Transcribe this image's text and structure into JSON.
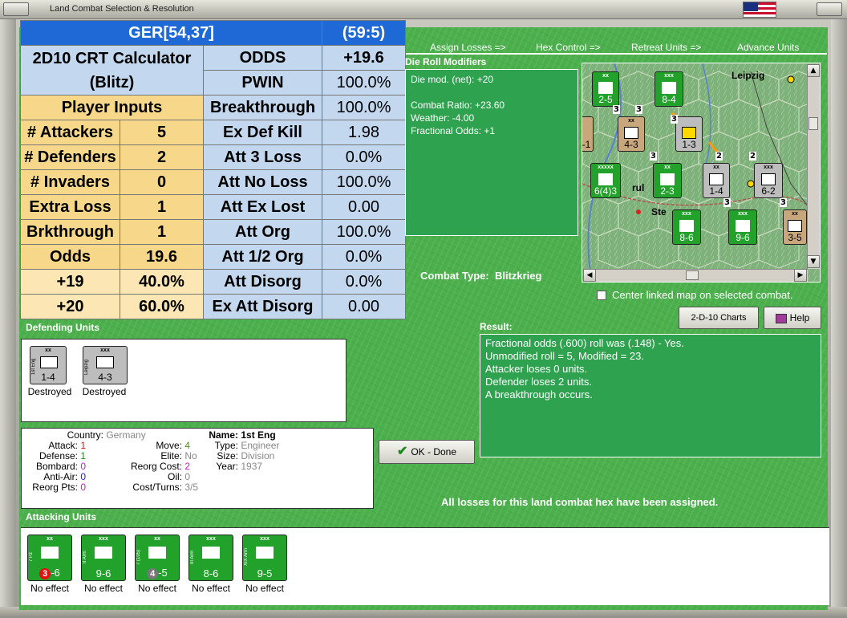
{
  "window": {
    "title": "Land Combat Selection & Resolution"
  },
  "menu": {
    "assign_losses": "Assign Losses =>",
    "hex_control": "Hex Control =>",
    "retreat_units": "Retreat Units =>",
    "advance_units": "Advance Units"
  },
  "crt": {
    "header_left": "GER[54,37]",
    "header_right": "(59:5)",
    "calc_title_1": "2D10 CRT Calculator",
    "calc_title_2": "(Blitz)",
    "player_inputs": "Player Inputs",
    "inputs": [
      {
        "label": "# Attackers",
        "value": "5"
      },
      {
        "label": "# Defenders",
        "value": "2"
      },
      {
        "label": "# Invaders",
        "value": "0"
      },
      {
        "label": "Extra Loss",
        "value": "1"
      },
      {
        "label": "Brkthrough",
        "value": "1"
      },
      {
        "label": "Odds",
        "value": "19.6"
      }
    ],
    "odds_rows": [
      {
        "label": "+19",
        "value": "40.0%"
      },
      {
        "label": "+20",
        "value": "60.0%"
      }
    ],
    "results": [
      {
        "label": "ODDS",
        "value": "+19.6"
      },
      {
        "label": "PWIN",
        "value": "100.0%"
      },
      {
        "label": "Breakthrough",
        "value": "100.0%"
      },
      {
        "label": "Ex Def Kill",
        "value": "1.98"
      },
      {
        "label": "Att 3 Loss",
        "value": "0.0%"
      },
      {
        "label": "Att No Loss",
        "value": "100.0%"
      },
      {
        "label": "Att Ex Lost",
        "value": "0.00"
      },
      {
        "label": "Att Org",
        "value": "100.0%"
      },
      {
        "label": "Att 1/2 Org",
        "value": "0.0%"
      },
      {
        "label": "Att Disorg",
        "value": "0.0%"
      },
      {
        "label": "Ex Att Disorg",
        "value": "0.00"
      }
    ]
  },
  "die_roll": {
    "title": "Die Roll Modifiers",
    "lines": [
      "Die mod. (net): +20",
      "",
      "Combat Ratio: +23.60",
      "Weather: -4.00",
      "Fractional Odds: +1"
    ]
  },
  "map": {
    "city_label_1": "Leipzig",
    "city_label_2": "Ste",
    "city_label_3": "rul",
    "counters": [
      {
        "size": "xx",
        "value": "2-5"
      },
      {
        "size": "xxx",
        "value": "8-4"
      },
      {
        "size": "xx",
        "value": "4-3"
      },
      {
        "size": "",
        "value": "1-3"
      },
      {
        "size": "xxxxx",
        "value": "6(4)3"
      },
      {
        "size": "xx",
        "value": "2-3"
      },
      {
        "size": "xx",
        "value": "1-4"
      },
      {
        "size": "xxx",
        "value": "6-2"
      },
      {
        "size": "xxx",
        "value": "8-6"
      },
      {
        "size": "xxx",
        "value": "9-6"
      },
      {
        "size": "xx",
        "value": "3-5"
      },
      {
        "size": "",
        "value": "-1"
      }
    ],
    "hex_numbers": [
      "3",
      "3",
      "3",
      "2",
      "3",
      "2",
      "3",
      "3"
    ]
  },
  "center_map_label": "Center linked map on selected combat.",
  "combat_type": {
    "label": "Combat Type:",
    "value": "Blitzkrieg"
  },
  "buttons": {
    "charts": "2-D-10 Charts",
    "help": "Help",
    "ok": "OK - Done"
  },
  "result": {
    "title": "Result:",
    "lines": [
      "Fractional odds (.600) roll was (.148)  - Yes.",
      "Unmodified roll = 5, Modified = 23.",
      "Attacker loses 0 units.",
      "Defender loses 2 units.",
      "A breakthrough occurs."
    ]
  },
  "defending": {
    "title": "Defending Units",
    "units": [
      {
        "size": "xx",
        "name": "1st Eng",
        "value": "1-4",
        "status": "Destroyed"
      },
      {
        "size": "xxx",
        "name": "Leipzig",
        "value": "4-3",
        "status": "Destroyed"
      }
    ]
  },
  "unit_info": {
    "country_k": "Country:",
    "country_v": "Germany",
    "attack_k": "Attack:",
    "attack_v": "1",
    "defense_k": "Defense:",
    "defense_v": "1",
    "bombard_k": "Bombard:",
    "bombard_v": "0",
    "antiair_k": "Anti-Air:",
    "antiair_v": "0",
    "reorg_k": "Reorg Pts:",
    "reorg_v": "0",
    "move_k": "Move:",
    "move_v": "4",
    "elite_k": "Elite:",
    "elite_v": "No",
    "reorgcost_k": "Reorg Cost:",
    "reorgcost_v": "2",
    "oil_k": "Oil:",
    "oil_v": "0",
    "costturns_k": "Cost/Turns:",
    "costturns_v": "3/5",
    "name_k": "Name:",
    "name_v": "1st Eng",
    "type_k": "Type:",
    "type_v": "Engineer",
    "size_k": "Size:",
    "size_v": "Division",
    "year_k": "Year:",
    "year_v": "1937"
  },
  "all_losses_msg": "All losses for this land combat hex have been assigned.",
  "attacking": {
    "title": "Attacking Units",
    "units": [
      {
        "size": "xx",
        "name": "7 Pz",
        "att": "3",
        "rest": "-6",
        "status": "No effect",
        "circle": "red"
      },
      {
        "size": "xxx",
        "name": "II Arm",
        "att": "",
        "rest": "9-6",
        "status": "No effect",
        "circle": ""
      },
      {
        "size": "xx",
        "name": "7 (105)",
        "att": "4",
        "rest": "-5",
        "status": "No effect",
        "circle": "grey"
      },
      {
        "size": "xxx",
        "name": "III Arm",
        "att": "",
        "rest": "8-6",
        "status": "No effect",
        "circle": ""
      },
      {
        "size": "xxx",
        "name": "XIX Arm",
        "att": "",
        "rest": "9-5",
        "status": "No effect",
        "circle": ""
      }
    ]
  },
  "colors": {
    "panel_green": "#4bb04b",
    "header_blue": "#1f69d6",
    "cell_blue": "#c3d8ef",
    "cell_yellow": "#f7d88b",
    "unit_green": "#22a22a"
  }
}
